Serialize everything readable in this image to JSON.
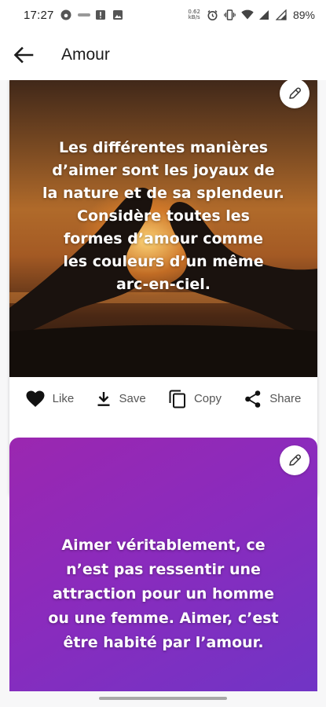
{
  "status_bar": {
    "time": "17:27",
    "speed_top": "0.62",
    "speed_bottom": "kB/s",
    "battery": "89%"
  },
  "app_bar": {
    "title": "Amour",
    "back_icon": "arrow-left-icon"
  },
  "cards": [
    {
      "quote": "Les différentes manières\nd’aimer sont les joyaux de\nla nature et de sa splendeur.\nConsidère toutes les\nformes d’amour comme\nles couleurs d’un même\narc-en-ciel.",
      "edit_icon": "pencil-icon",
      "actions": {
        "like": "Like",
        "save": "Save",
        "copy": "Copy",
        "share": "Share"
      }
    },
    {
      "quote": "Aimer véritablement, ce\nn’est pas ressentir une\nattraction pour un homme\nou une femme. Aimer, c’est\nêtre habité par l’amour.",
      "edit_icon": "pencil-icon",
      "background_color": "#8a2bbd"
    }
  ]
}
